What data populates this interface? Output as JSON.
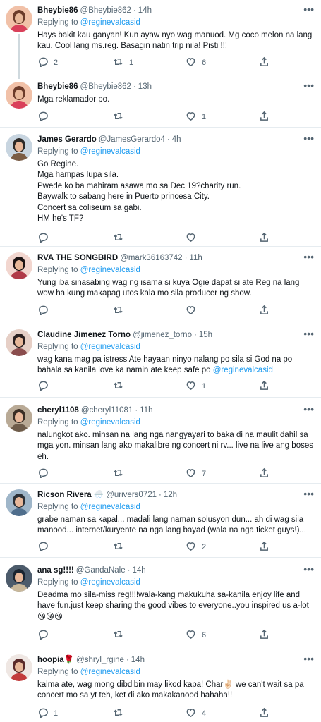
{
  "replying_to_label": "Replying to",
  "replying_to_handle": "@reginevalcasid",
  "tweets": [
    {
      "name": "Bheybie86",
      "handle": "@Bheybie862",
      "time": "14h",
      "replying": true,
      "lines": [
        "Hays bakit kau ganyan! Kun ayaw nyo wag manuod. Mg coco melon na lang",
        "kau. Cool lang ms.reg. Basagin natin trip nila! Pisti !!!"
      ],
      "replies": "2",
      "retweets": "1",
      "likes": "6"
    },
    {
      "name": "Bheybie86",
      "handle": "@Bheybie862",
      "time": "13h",
      "replying": false,
      "lines": [
        "Mga reklamador po."
      ],
      "replies": "",
      "retweets": "",
      "likes": "1"
    },
    {
      "name": "James Gerardo",
      "handle": "@JamesGerardo4",
      "time": "4h",
      "replying": true,
      "lines": [
        "Go Regine.",
        "Mga hampas lupa sila.",
        "Pwede ko ba mahiram asawa mo sa Dec 19?charity run.",
        "Baywalk to sabang here in Puerto princesa City.",
        "Concert sa coliseum sa gabi.",
        "HM he's TF?"
      ],
      "replies": "",
      "retweets": "",
      "likes": ""
    },
    {
      "name": "RVA THE SONGBIRD",
      "handle": "@mark36163742",
      "time": "11h",
      "replying": true,
      "lines": [
        "Yung iba sinasabing wag ng isama si kuya Ogie dapat si ate Reg na lang",
        "wow ha kung makapag utos kala mo sila producer ng show."
      ],
      "replies": "",
      "retweets": "",
      "likes": ""
    },
    {
      "name": "Claudine Jimenez Torno",
      "handle": "@jimenez_torno",
      "time": "15h",
      "replying": true,
      "lines": [
        "wag kana mag pa istress Ate hayaan ninyo nalang po sila  si God  na po",
        "bahala sa kanila love ka namin ate keep safe po "
      ],
      "trailing_mention": "@reginevalcasid",
      "replies": "",
      "retweets": "",
      "likes": "1"
    },
    {
      "name": "cheryl1108",
      "handle": "@cheryl11081",
      "time": "11h",
      "replying": true,
      "lines": [
        "nalungkot ako. minsan na lang nga nangyayari to baka di na maulit dahil sa",
        "mga yon. minsan lang ako makalibre ng concert ni rv... live na live ang boses",
        "eh."
      ],
      "replies": "",
      "retweets": "",
      "likes": "7"
    },
    {
      "name": "Ricson Rivera 🌨️",
      "handle": "@urivers0721",
      "time": "12h",
      "replying": true,
      "lines": [
        "grabe naman sa kapal... madali lang naman solusyon dun... ah di wag sila",
        "manood... internet/kuryente na nga lang bayad (wala na nga ticket guys!)..."
      ],
      "replies": "",
      "retweets": "",
      "likes": "2"
    },
    {
      "name": "ana sg!!!!",
      "handle": "@GandaNale",
      "time": "14h",
      "replying": true,
      "lines": [
        "Deadma mo sila-miss reg!!!!wala-kang makukuha sa-kanila enjoy life and",
        "have fun.just keep sharing the good vibes to everyone..you inspired us a-lot",
        "😘😘😘"
      ],
      "replies": "",
      "retweets": "",
      "likes": "6"
    },
    {
      "name": "hoopia🌹",
      "handle": "@shryl_rgine",
      "time": "14h",
      "replying": true,
      "lines": [
        "kalma ate, wag mong dibdibin may likod kapa! Char✌🏻 we can't wait sa pa",
        "concert mo sa yt teh, ket di ako makakanood hahaha!!"
      ],
      "replies": "1",
      "retweets": "",
      "likes": "4"
    }
  ],
  "icons": {
    "more": "more-horizontal-icon",
    "reply": "reply-bubble-icon",
    "retweet": "retweet-icon",
    "like": "heart-icon",
    "share": "share-icon"
  },
  "colors": {
    "accent": "#1d9bf0",
    "muted": "#536471",
    "divider": "#e6ecf0"
  }
}
